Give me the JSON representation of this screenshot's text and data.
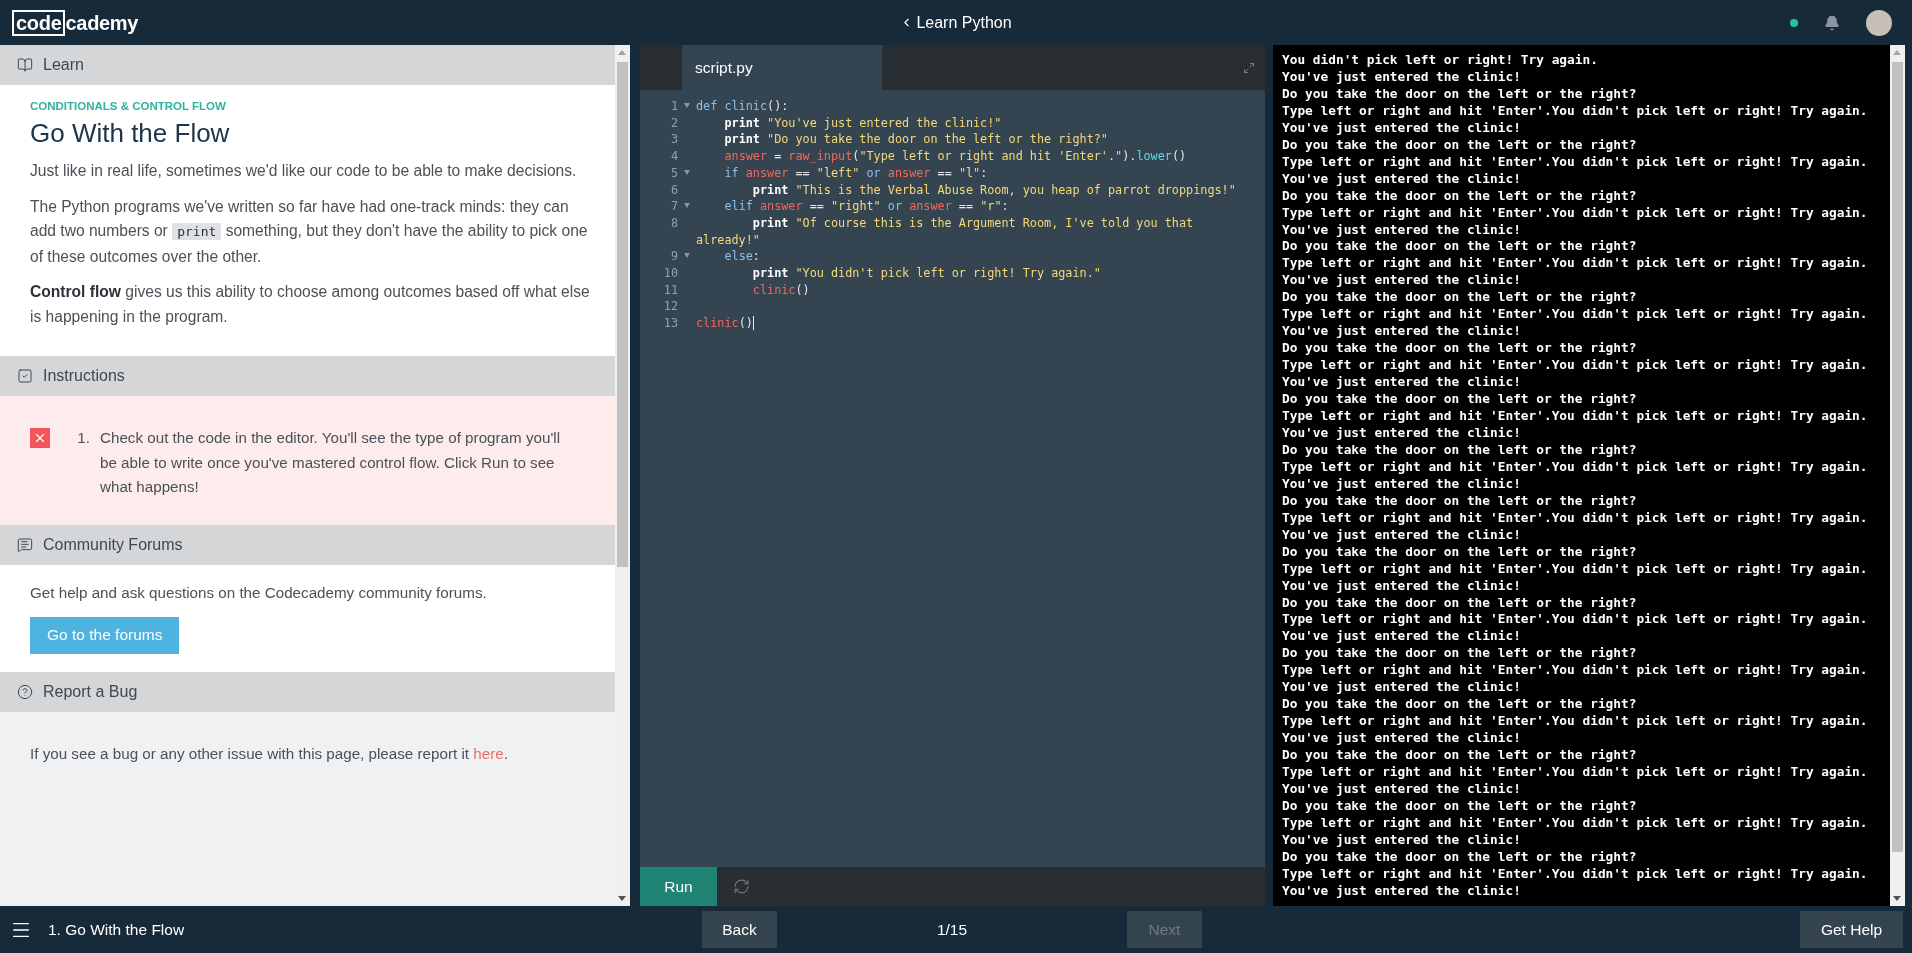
{
  "header": {
    "logo": {
      "boxed_part": "code",
      "plain_part": "cademy"
    },
    "course_title": "Learn Python"
  },
  "lesson": {
    "sections": [
      {
        "kind": "learn",
        "title": "Learn"
      },
      {
        "kind": "instructions",
        "title": "Instructions"
      },
      {
        "kind": "forums",
        "title": "Community Forums"
      },
      {
        "kind": "bug",
        "title": "Report a Bug"
      }
    ],
    "learn": {
      "eyebrow": "CONDITIONALS & CONTROL FLOW",
      "title": "Go With the Flow",
      "paragraphs": [
        [
          {
            "kind": "text",
            "text": "Just like in real life, sometimes we'd like our code to be able to make decisions."
          }
        ],
        [
          {
            "kind": "text",
            "text": "The Python programs we've written so far have had one-track minds: they can add two numbers or "
          },
          {
            "kind": "code",
            "text": "print"
          },
          {
            "kind": "text",
            "text": " something, but they don't have the ability to pick one of these outcomes over the other."
          }
        ],
        [
          {
            "kind": "text",
            "text": "**Control flow** gives us this ability to choose among outcomes based off what else is happening in the program."
          }
        ]
      ]
    },
    "instructions": [
      {
        "number": "1.",
        "text": "Check out the code in the editor. You'll see the type of program you'll be able to write once you've mastered control flow. Click Run to see what happens!",
        "passed": false
      }
    ],
    "forums": {
      "text": "Get help and ask questions on the Codecademy community forums.",
      "button": "Go to the forums"
    },
    "bug": {
      "before": "If you see a bug or any other issue with this page, please report it ",
      "link": "here",
      "after": "."
    }
  },
  "editor": {
    "tab": "script.py",
    "run_button": "Run",
    "lines": [
      {
        "number": "1",
        "fold": true,
        "tokens": [
          {
            "kind": "kw",
            "text": "def clinic"
          },
          {
            "kind": "plain",
            "text": "():"
          }
        ]
      },
      {
        "number": "2",
        "fold": false,
        "tokens": [
          {
            "kind": "print",
            "text": "    print"
          },
          {
            "kind": "str",
            "text": " \"You've just entered the clinic!\""
          }
        ]
      },
      {
        "number": "3",
        "fold": false,
        "tokens": [
          {
            "kind": "print",
            "text": "    print"
          },
          {
            "kind": "str",
            "text": " \"Do you take the door on the left or the right?\""
          }
        ]
      },
      {
        "number": "4",
        "fold": false,
        "tokens": [
          {
            "kind": "var",
            "text": "    answer"
          },
          {
            "kind": "plain",
            "text": " = "
          },
          {
            "kind": "var",
            "text": "raw_input"
          },
          {
            "kind": "plain",
            "text": "("
          },
          {
            "kind": "str",
            "text": "\"Type left or right and hit 'Enter'.\""
          },
          {
            "kind": "plain",
            "text": ")."
          },
          {
            "kind": "method",
            "text": "lower"
          },
          {
            "kind": "plain",
            "text": "()"
          }
        ]
      },
      {
        "number": "5",
        "fold": true,
        "tokens": [
          {
            "kind": "kw",
            "text": "    if "
          },
          {
            "kind": "var",
            "text": "answer"
          },
          {
            "kind": "plain",
            "text": " == "
          },
          {
            "kind": "str",
            "text": "\"left\""
          },
          {
            "kind": "kw",
            "text": " or "
          },
          {
            "kind": "var",
            "text": "answer"
          },
          {
            "kind": "plain",
            "text": " == "
          },
          {
            "kind": "str",
            "text": "\"l\""
          },
          {
            "kind": "plain",
            "text": ":"
          }
        ]
      },
      {
        "number": "6",
        "fold": false,
        "tokens": [
          {
            "kind": "print",
            "text": "        print"
          },
          {
            "kind": "str",
            "text": " \"This is the Verbal Abuse Room, you heap of parrot droppings!\""
          }
        ]
      },
      {
        "number": "7",
        "fold": true,
        "tokens": [
          {
            "kind": "kw",
            "text": "    elif "
          },
          {
            "kind": "var",
            "text": "answer"
          },
          {
            "kind": "plain",
            "text": " == "
          },
          {
            "kind": "str",
            "text": "\"right\""
          },
          {
            "kind": "kw",
            "text": " or "
          },
          {
            "kind": "var",
            "text": "answer"
          },
          {
            "kind": "plain",
            "text": " == "
          },
          {
            "kind": "str",
            "text": "\"r\""
          },
          {
            "kind": "plain",
            "text": ":"
          }
        ]
      },
      {
        "number": "8",
        "fold": false,
        "tokens": [
          {
            "kind": "print",
            "text": "        print"
          },
          {
            "kind": "str",
            "text": " \"Of course this is the Argument Room, I've told you that already!\""
          }
        ]
      },
      {
        "number": "9",
        "fold": true,
        "tokens": [
          {
            "kind": "kw",
            "text": "    else"
          },
          {
            "kind": "plain",
            "text": ":"
          }
        ]
      },
      {
        "number": "10",
        "fold": false,
        "tokens": [
          {
            "kind": "print",
            "text": "        print"
          },
          {
            "kind": "str",
            "text": " \"You didn't pick left or right! Try again.\""
          }
        ]
      },
      {
        "number": "11",
        "fold": false,
        "tokens": [
          {
            "kind": "var",
            "text": "        clinic"
          },
          {
            "kind": "plain",
            "text": "()"
          }
        ]
      },
      {
        "number": "12",
        "fold": false
      },
      {
        "number": "13",
        "fold": false,
        "tokens": [
          {
            "kind": "var",
            "text": "clinic"
          },
          {
            "kind": "plain",
            "text": "()"
          }
        ]
      }
    ]
  },
  "terminal": {
    "lines": [
      "You didn't pick left or right! Try again.",
      "You've just entered the clinic!",
      "Do you take the door on the left or the right?",
      "Type left or right and hit 'Enter'.You didn't pick left or right! Try again.",
      "You've just entered the clinic!",
      "Do you take the door on the left or the right?",
      "Type left or right and hit 'Enter'.You didn't pick left or right! Try again.",
      "You've just entered the clinic!",
      "Do you take the door on the left or the right?",
      "Type left or right and hit 'Enter'.You didn't pick left or right! Try again.",
      "You've just entered the clinic!",
      "Do you take the door on the left or the right?",
      "Type left or right and hit 'Enter'.You didn't pick left or right! Try again.",
      "You've just entered the clinic!",
      "Do you take the door on the left or the right?",
      "Type left or right and hit 'Enter'.You didn't pick left or right! Try again.",
      "You've just entered the clinic!",
      "Do you take the door on the left or the right?",
      "Type left or right and hit 'Enter'.You didn't pick left or right! Try again.",
      "You've just entered the clinic!",
      "Do you take the door on the left or the right?",
      "Type left or right and hit 'Enter'.You didn't pick left or right! Try again.",
      "You've just entered the clinic!",
      "Do you take the door on the left or the right?",
      "Type left or right and hit 'Enter'.You didn't pick left or right! Try again.",
      "You've just entered the clinic!",
      "Do you take the door on the left or the right?",
      "Type left or right and hit 'Enter'.You didn't pick left or right! Try again.",
      "You've just entered the clinic!",
      "Do you take the door on the left or the right?",
      "Type left or right and hit 'Enter'.You didn't pick left or right! Try again.",
      "You've just entered the clinic!",
      "Do you take the door on the left or the right?",
      "Type left or right and hit 'Enter'.You didn't pick left or right! Try again.",
      "You've just entered the clinic!",
      "Do you take the door on the left or the right?",
      "Type left or right and hit 'Enter'.You didn't pick left or right! Try again.",
      "You've just entered the clinic!",
      "Do you take the door on the left or the right?",
      "Type left or right and hit 'Enter'.You didn't pick left or right! Try again.",
      "You've just entered the clinic!",
      "Do you take the door on the left or the right?",
      "Type left or right and hit 'Enter'.You didn't pick left or right! Try again.",
      "You've just entered the clinic!",
      "Do you take the door on the left or the right?",
      "Type left or right and hit 'Enter'.You didn't pick left or right! Try again.",
      "You've just entered the clinic!",
      "Do you take the door on the left or the right?",
      "Type left or right and hit 'Enter'.You didn't pick left or right! Try again.",
      "You've just entered the clinic!"
    ]
  },
  "footer": {
    "lesson_title": "1. Go With the Flow",
    "back_button": {
      "label": "Back",
      "disabled": false
    },
    "progress": "1/15",
    "next_button": {
      "label": "Next",
      "disabled": true
    },
    "help_button": "Get Help"
  }
}
